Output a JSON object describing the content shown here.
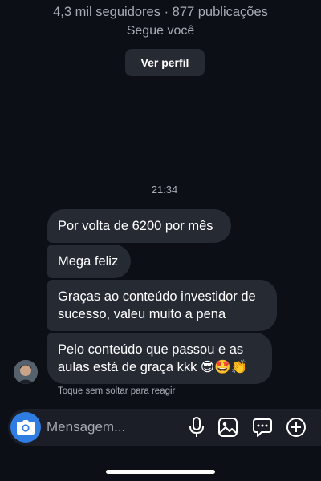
{
  "profile": {
    "stats": "4,3 mil seguidores · 877 publicações",
    "follow_status": "Segue você",
    "view_profile_label": "Ver perfil"
  },
  "chat": {
    "timestamp": "21:34",
    "messages": [
      {
        "text": "Por volta de 6200 por mês"
      },
      {
        "text": "Mega feliz"
      },
      {
        "text": "Graças ao conteúdo investidor de sucesso, valeu muito a pena"
      },
      {
        "text": "Pelo conteúdo que passou e as aulas está de graça kkk 😎🤩👏"
      }
    ],
    "reaction_hint": "Toque sem soltar para reagir"
  },
  "composer": {
    "placeholder": "Mensagem...",
    "icons": [
      "camera-icon",
      "microphone-icon",
      "gallery-icon",
      "sticker-icon",
      "plus-icon"
    ]
  },
  "colors": {
    "background": "#0c0f16",
    "bubble": "#262a33",
    "secondary_text": "#a7abb3",
    "accent": "#2f7de2"
  }
}
